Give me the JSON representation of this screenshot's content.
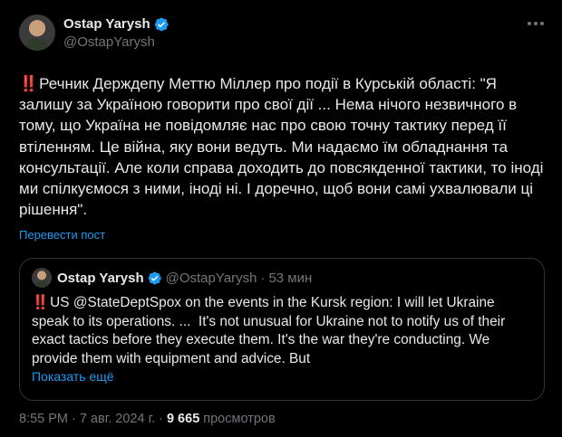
{
  "author": {
    "display_name": "Ostap Yarysh",
    "handle": "@OstapYarysh"
  },
  "post": {
    "emoji": "‼️",
    "text": "Речник Держдепу Меттю Міллер про події в Курській області: \"Я залишу за Україною говорити про свої дії ... Нема нічого незвичного в тому, що Україна не повідомляє нас про свою точну тактику перед її втіленням. Це війна, яку вони ведуть. Ми надаємо їм обладнання та консультації. Але коли справа доходить до повсякденної тактики, то іноді ми спілкуємося з ними, іноді ні. І доречно, щоб вони самі ухвалювали ці рішення\".",
    "translate_label": "Перевести пост"
  },
  "quote": {
    "display_name": "Ostap Yarysh",
    "handle": "@OstapYarysh",
    "dot": "·",
    "time": "53 мин",
    "emoji": "‼️",
    "text": "US @StateDeptSpox on the events in the Kursk region: I will let Ukraine speak to its operations. ...  It's not unusual for Ukraine not to notify us of their exact tactics before they execute them. It's the war they're conducting. We provide them with equipment and advice. But",
    "show_more_label": "Показать ещё"
  },
  "meta": {
    "time": "8:55 PM",
    "date": "7 авг. 2024 г.",
    "views_count": "9 665",
    "views_label": "просмотров"
  },
  "colors": {
    "background": "#000000",
    "text": "#e7e9ea",
    "muted": "#71767b",
    "link": "#1d9bf0",
    "verified": "#1d9bf0",
    "border": "#2f3336"
  },
  "icons": [
    "verified-badge-icon",
    "more-options-icon"
  ]
}
